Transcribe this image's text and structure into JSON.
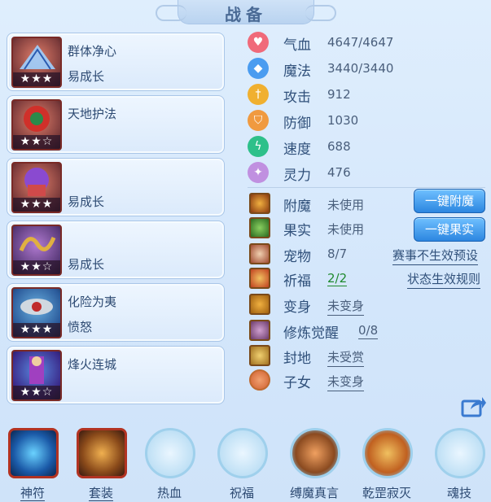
{
  "title": "战备",
  "slots": [
    {
      "line1": "群体净心",
      "line2": "易成长",
      "stars": "★★★",
      "art_color": "#4a8fd6"
    },
    {
      "line1": "天地护法",
      "line2": "",
      "stars": "★★☆",
      "art_color": "#c0302a"
    },
    {
      "line1": "",
      "line2": "易成长",
      "stars": "★★★",
      "art_color": "#8a4ad0"
    },
    {
      "line1": "",
      "line2": "易成长",
      "stars": "★★☆",
      "art_color": "#d0a030"
    },
    {
      "line1": "化险为夷",
      "line2": "愤怒",
      "stars": "★★★",
      "art_color": "#3a90c0"
    },
    {
      "line1": "烽火连城",
      "line2": "",
      "stars": "★★☆",
      "art_color": "#8030a0"
    }
  ],
  "attributes": [
    {
      "label": "气血",
      "value": "4647/4647",
      "icon": "heart-icon",
      "color": "#f06a7a"
    },
    {
      "label": "魔法",
      "value": "3440/3440",
      "icon": "mana-icon",
      "color": "#4a9cf0"
    },
    {
      "label": "攻击",
      "value": "912",
      "icon": "sword-icon",
      "color": "#f0b030"
    },
    {
      "label": "防御",
      "value": "1030",
      "icon": "shield-icon",
      "color": "#f09a40"
    },
    {
      "label": "速度",
      "value": "688",
      "icon": "lightning-icon",
      "color": "#2ec08a"
    },
    {
      "label": "灵力",
      "value": "476",
      "icon": "spirit-icon",
      "color": "#c090e0"
    }
  ],
  "status": [
    {
      "label": "附魔",
      "value": "未使用",
      "underline": false
    },
    {
      "label": "果实",
      "value": "未使用",
      "underline": false
    },
    {
      "label": "宠物",
      "value": "8/7",
      "underline": false
    },
    {
      "label": "祈福",
      "value": "2/2",
      "underline": true,
      "green": true
    },
    {
      "label": "变身",
      "value": "未变身",
      "underline": true
    },
    {
      "label": "修炼觉醒",
      "value": "0/8",
      "underline": true
    },
    {
      "label": "封地",
      "value": "未受赏",
      "underline": true
    },
    {
      "label": "子女",
      "value": "未变身",
      "underline": true
    }
  ],
  "buttons": {
    "enchant": "一键附魔",
    "fruit": "一键果实"
  },
  "links": {
    "event_preset": "赛事不生效预设",
    "status_rules": "状态生效规则"
  },
  "tabs": [
    {
      "label": "神符",
      "active": true
    },
    {
      "label": "套装",
      "active": true
    },
    {
      "label": "热血",
      "active": false
    },
    {
      "label": "祝福",
      "active": false
    },
    {
      "label": "缚魔真言",
      "active": false
    },
    {
      "label": "乾罡寂灭",
      "active": false
    },
    {
      "label": "魂技",
      "active": false
    }
  ]
}
